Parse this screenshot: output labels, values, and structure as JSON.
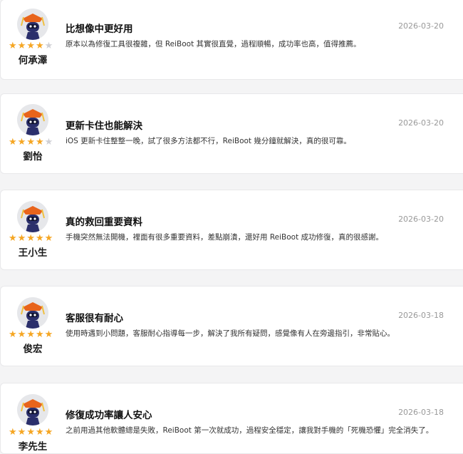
{
  "reviews": [
    {
      "name": "何承澤",
      "title": "比想像中更好用",
      "date": "2026-03-20",
      "text": "原本以為修復工具很複雜，但 ReiBoot 其實很直覺，過程順暢，成功率也高，值得推薦。",
      "rating": 4
    },
    {
      "name": "劉怡",
      "title": "更新卡住也能解決",
      "date": "2026-03-20",
      "text": "iOS 更新卡住整整一晚，試了很多方法都不行，ReiBoot 幾分鐘就解決，真的很可靠。",
      "rating": 4
    },
    {
      "name": "王小生",
      "title": "真的救回重要資料",
      "date": "2026-03-20",
      "text": "手機突然無法開機，裡面有很多重要資料，差點崩潰，還好用 ReiBoot 成功修復，真的很感謝。",
      "rating": 5
    },
    {
      "name": "俊宏",
      "title": "客服很有耐心",
      "date": "2026-03-18",
      "text": "使用時遇到小問題，客服耐心指導每一步，解決了我所有疑問，感覺像有人在旁邊指引，非常貼心。",
      "rating": 5
    },
    {
      "name": "李先生",
      "title": "修復成功率讓人安心",
      "date": "2026-03-18",
      "text": "之前用過其他軟體總是失敗，ReiBoot 第一次就成功，過程安全穩定，讓我對手機的「死機恐懼」完全消失了。",
      "rating": 5
    }
  ],
  "colors": {
    "star": "#f5a623",
    "star_off": "#cfcfd4",
    "avatar_hat": "#e8641c",
    "avatar_body": "#2b2f6b"
  },
  "icons": {
    "avatar": "robot-avatar-icon",
    "star": "star-icon"
  }
}
